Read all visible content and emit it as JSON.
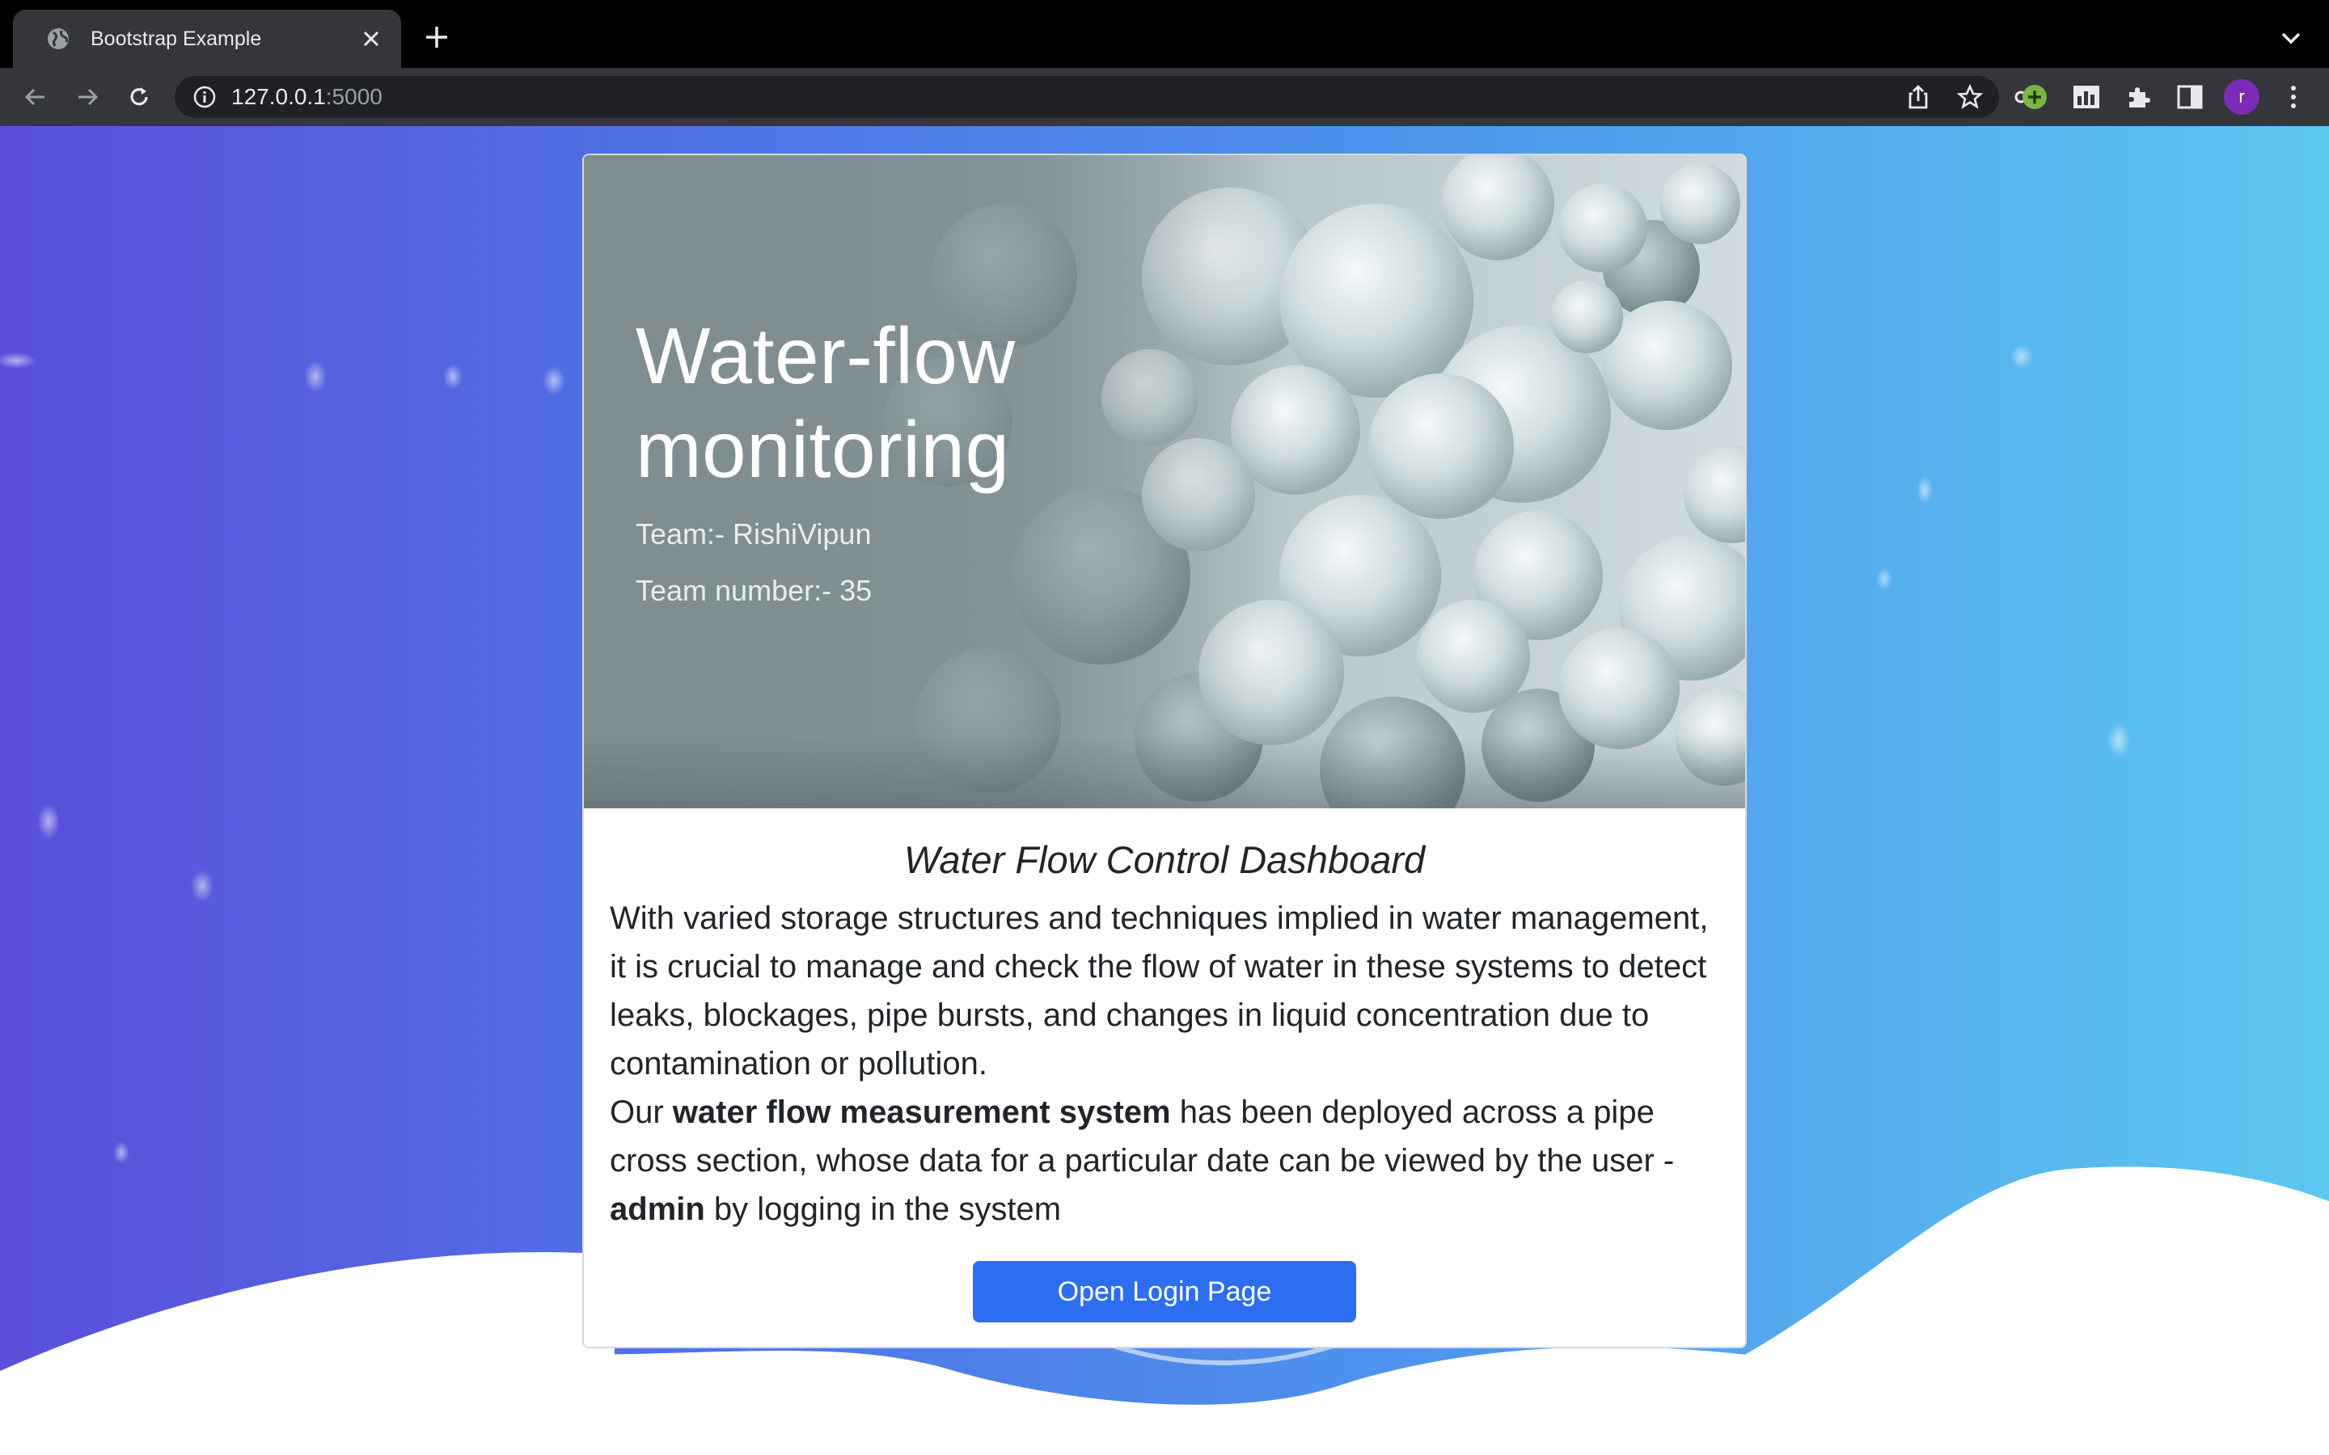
{
  "browser": {
    "tab_title": "Bootstrap Example",
    "url_host": "127.0.0.1",
    "url_port": ":5000",
    "profile_initial": "r",
    "icons": [
      "globe-icon",
      "close-icon",
      "plus-icon",
      "back-icon",
      "forward-icon",
      "reload-icon",
      "info-icon",
      "key-icon",
      "share-icon",
      "star-icon",
      "extension-plus-icon",
      "chart-extension-icon",
      "puzzle-icon",
      "side-panel-icon",
      "more-vert-icon"
    ]
  },
  "hero": {
    "title": "Water-flow monitoring",
    "team": "Team:- RishiVipun",
    "team_number": "Team number:- 35"
  },
  "dashboard": {
    "heading": "Water Flow Control Dashboard",
    "para1": "With varied storage structures and techniques implied in water management, it is crucial to manage and check the flow of water in these systems to detect leaks, blockages, pipe bursts, and changes in liquid concentration due to contamination or pollution.",
    "para2_before": "Our ",
    "para2_bold": "water flow measurement system",
    "para2_after": " has been deployed across a pipe cross section, whose data for a particular date can be viewed by the user - ",
    "para2_bold2": "admin",
    "para2_end": " by logging in the system",
    "button_label": "Open Login Page"
  },
  "colors": {
    "accent_button": "#2d6ef0",
    "bg_left": "#5b4fdb",
    "bg_right": "#5cc8f0",
    "profile": "#7b2bb5"
  }
}
